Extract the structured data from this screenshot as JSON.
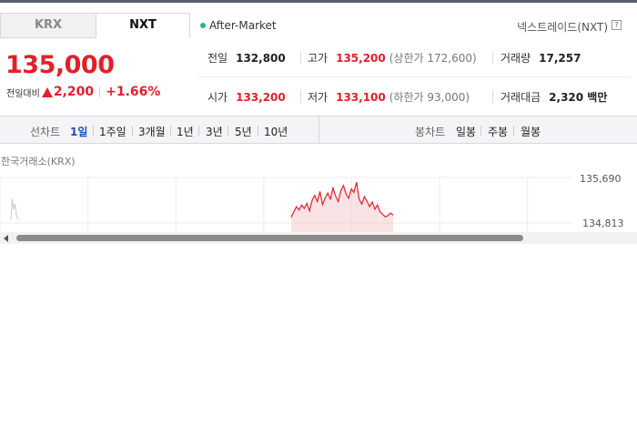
{
  "tabs": {
    "krx": "KRX",
    "nxt": "NXT"
  },
  "session": "After-Market",
  "nxt_label": "넥스트레이드(NXT)",
  "help": "?",
  "price": "135,000",
  "change": {
    "label": "전일대비",
    "amount": "2,200",
    "percent": "+1.66%"
  },
  "stats": {
    "prev_close": {
      "label": "전일",
      "value": "132,800"
    },
    "high": {
      "label": "고가",
      "value": "135,200",
      "sub": "(상한가 172,600)"
    },
    "volume": {
      "label": "거래량",
      "value": "17,257"
    },
    "open": {
      "label": "시가",
      "value": "133,200"
    },
    "low": {
      "label": "저가",
      "value": "133,100",
      "sub": "(하한가 93,000)"
    },
    "amount": {
      "label": "거래대금",
      "value": "2,320 백만"
    }
  },
  "period_bar": {
    "line_label": "선차트",
    "periods": [
      "1일",
      "1주일",
      "3개월",
      "1년",
      "3년",
      "5년",
      "10년"
    ],
    "active_period": "1일",
    "candle_label": "봉차트",
    "candles": [
      "일봉",
      "주봉",
      "월봉"
    ]
  },
  "chart_data": {
    "type": "line",
    "title": "한국거래소(KRX)",
    "y_ticks": [
      "135,690",
      "134,813"
    ],
    "ylim": [
      134400,
      135690
    ],
    "grid": true,
    "series": [
      {
        "color": "#e0202a",
        "x": [
          0,
          1,
          2,
          3,
          4,
          5,
          6,
          7,
          8,
          9,
          10,
          11,
          12,
          13,
          14,
          15,
          16,
          17,
          18,
          19,
          20,
          21,
          22,
          23,
          24,
          25,
          26,
          27,
          28,
          29,
          30,
          31,
          32,
          33,
          34,
          35,
          36,
          37,
          38,
          39
        ],
        "values": [
          134750,
          134880,
          135000,
          134920,
          135040,
          134960,
          135080,
          134900,
          135150,
          135270,
          135120,
          135360,
          135050,
          135210,
          135320,
          135180,
          135440,
          135250,
          135120,
          135380,
          135500,
          135300,
          135200,
          135420,
          135340,
          135580,
          135180,
          135060,
          135240,
          135130,
          135000,
          135110,
          134940,
          135040,
          134880,
          134820,
          134760,
          134790,
          134850,
          134800
        ]
      }
    ],
    "ghost_series": [
      {
        "color": "#c7c7cf",
        "values": [
          134700,
          135180,
          134940,
          135060,
          134820,
          134700
        ]
      }
    ],
    "area_color": "#f7d0d2"
  },
  "scroll": {
    "arrow": "left"
  }
}
